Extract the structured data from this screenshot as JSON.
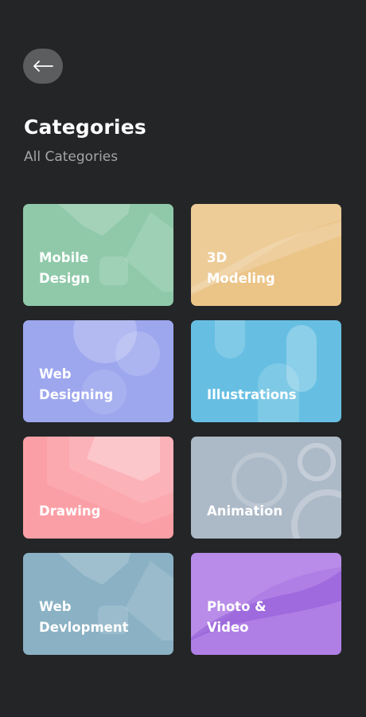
{
  "header": {
    "back_icon": "arrow-left-icon",
    "title": "Categories",
    "subtitle": "All Categories"
  },
  "categories": [
    {
      "label": "Mobile\nDesign",
      "color": "#8fc9aa"
    },
    {
      "label": "3D\nModeling",
      "color": "#ebc488"
    },
    {
      "label": "Web\nDesigning",
      "color": "#9da7ee"
    },
    {
      "label": "Illustrations",
      "color": "#66bfe2"
    },
    {
      "label": "Drawing",
      "color": "#fb9fa6"
    },
    {
      "label": "Animation",
      "color": "#acb9c7"
    },
    {
      "label": "Web\nDevlopment",
      "color": "#8ab1c4"
    },
    {
      "label": "Photo &\nVideo",
      "color": "#b07fe6"
    }
  ]
}
